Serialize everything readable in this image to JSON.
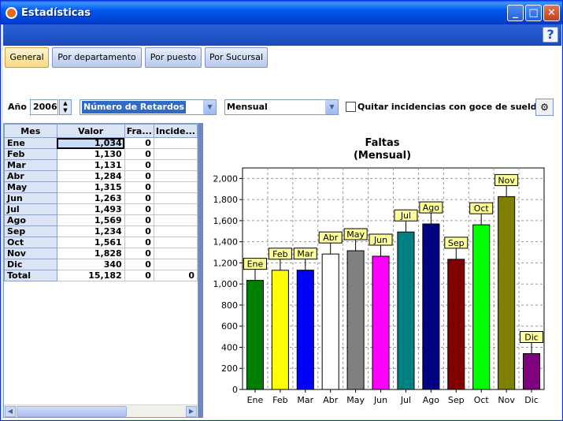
{
  "window": {
    "title": "Estadísticas",
    "help": "?"
  },
  "tabs": [
    "General",
    "Por departamento",
    "Por puesto",
    "Por Sucursal"
  ],
  "filters": {
    "year_label": "Año",
    "year": "2006",
    "metric": "Número de Retardos",
    "period": "Mensual",
    "checkbox_label": "Quitar incidencias con goce de sueldo",
    "checkbox_checked": false
  },
  "table": {
    "columns": [
      "Mes",
      "Valor",
      "Fra...",
      "Incide..."
    ],
    "rows": [
      [
        "Ene",
        "1,034",
        "0",
        ""
      ],
      [
        "Feb",
        "1,130",
        "0",
        ""
      ],
      [
        "Mar",
        "1,131",
        "0",
        ""
      ],
      [
        "Abr",
        "1,284",
        "0",
        ""
      ],
      [
        "May",
        "1,315",
        "0",
        ""
      ],
      [
        "Jun",
        "1,263",
        "0",
        ""
      ],
      [
        "Jul",
        "1,493",
        "0",
        ""
      ],
      [
        "Ago",
        "1,569",
        "0",
        ""
      ],
      [
        "Sep",
        "1,234",
        "0",
        ""
      ],
      [
        "Oct",
        "1,561",
        "0",
        ""
      ],
      [
        "Nov",
        "1,828",
        "0",
        ""
      ],
      [
        "Dic",
        "340",
        "0",
        ""
      ],
      [
        "Total",
        "15,182",
        "0",
        "0"
      ]
    ]
  },
  "chart_data": {
    "type": "bar",
    "title": "Faltas",
    "subtitle": "(Mensual)",
    "categories": [
      "Ene",
      "Feb",
      "Mar",
      "Abr",
      "May",
      "Jun",
      "Jul",
      "Ago",
      "Sep",
      "Oct",
      "Nov",
      "Dic"
    ],
    "values": [
      1034,
      1130,
      1131,
      1284,
      1315,
      1263,
      1493,
      1569,
      1234,
      1561,
      1828,
      340
    ],
    "colors": [
      "#008000",
      "#ffff00",
      "#0000ff",
      "#ffffff",
      "#808080",
      "#ff00ff",
      "#008080",
      "#000080",
      "#800000",
      "#00ff00",
      "#808000",
      "#800080"
    ],
    "ylim": [
      0,
      2100
    ],
    "yticks": [
      0,
      200,
      400,
      600,
      800,
      1000,
      1200,
      1400,
      1600,
      1800,
      2000
    ],
    "ytick_labels": [
      "0",
      "200",
      "400",
      "600",
      "800",
      "1,000",
      "1,200",
      "1,400",
      "1,600",
      "1,800",
      "2,000"
    ],
    "grid": true,
    "data_labels": "category"
  }
}
